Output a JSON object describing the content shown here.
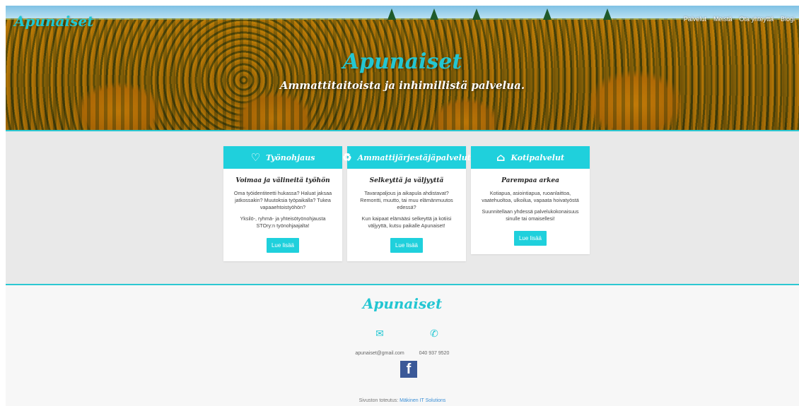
{
  "header": {
    "brand": "Apunaiset",
    "nav": [
      "Palvelut",
      "Meistä",
      "Ota yhteyttä",
      "Blogi"
    ]
  },
  "hero": {
    "title": "Apunaiset",
    "subtitle": "Ammattitaitoista ja inhimillistä palvelua."
  },
  "services": [
    {
      "icon": "heart-icon",
      "title": "Työnohjaus",
      "subtitle": "Voimaa ja välineitä työhön",
      "paragraphs": [
        "Oma työidentiteetti hukassa? Haluat jaksaa jatkossakin? Muutoksia työpaikalla? Tukea vapaaehtoistyöhön?",
        "Yksilö-, ryhmä- ja yhteisötyönohjausta STOry:n työnohjaajalta!"
      ],
      "button": "Lue lisää"
    },
    {
      "icon": "recycle-icon",
      "title": "Ammattijärjestäjäpalvelut",
      "subtitle": "Selkeyttä ja väljyyttä",
      "paragraphs": [
        "Tavarapaljous ja aikapula ahdistavat? Remontti, muutto, tai muu elämänmuutos edessä?",
        "Kun kaipaat elämääsi selkeyttä ja kotiisi väljyyttä, kutsu paikalle Apunaiset!"
      ],
      "button": "Lue lisää"
    },
    {
      "icon": "home-icon",
      "title": "Kotipalvelut",
      "subtitle": "Parempaa arkea",
      "paragraphs": [
        "Kotiapua, asiointiapua, ruoanlaittoa, vaatehuoltoa, ulkoilua, vapaata hoivatyöstä",
        "Suunnitellaan yhdessä palvelukokonaisuus sinulle tai omaisellesi!"
      ],
      "button": "Lue lisää"
    }
  ],
  "footer": {
    "brand": "Apunaiset",
    "email": "apunaiset@gmail.com",
    "phone": "040 937 9520",
    "credits_prefix": "Sivuston toteutus:",
    "credits_link": "Mäkinen IT Solutions"
  }
}
